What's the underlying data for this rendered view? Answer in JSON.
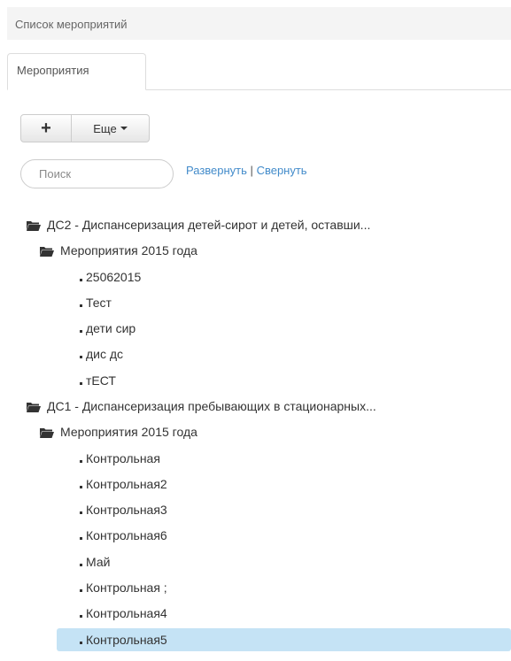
{
  "header": {
    "title": "Список мероприятий"
  },
  "tabs": [
    {
      "label": "Мероприятия"
    }
  ],
  "toolbar": {
    "add_label": "+",
    "more_label": "Еще"
  },
  "search": {
    "placeholder": "Поиск",
    "value": ""
  },
  "links": {
    "expand": "Развернуть",
    "separator": "|",
    "collapse": "Свернуть"
  },
  "tree": [
    {
      "type": "folder",
      "label": "ДС2 - Диспансеризация детей-сирот и детей, оставши..."
    },
    {
      "type": "folder",
      "label": "Мероприятия 2015 года"
    },
    {
      "type": "leaf",
      "label": "25062015"
    },
    {
      "type": "leaf",
      "label": "Тест"
    },
    {
      "type": "leaf",
      "label": "дети сир"
    },
    {
      "type": "leaf",
      "label": "дис дс"
    },
    {
      "type": "leaf",
      "label": "тЕСТ"
    },
    {
      "type": "folder",
      "label": "ДС1 - Диспансеризация пребывающих в стационарных..."
    },
    {
      "type": "folder",
      "label": "Мероприятия 2015 года"
    },
    {
      "type": "leaf",
      "label": "Контрольная"
    },
    {
      "type": "leaf",
      "label": "Контрольная2"
    },
    {
      "type": "leaf",
      "label": "Контрольная3"
    },
    {
      "type": "leaf",
      "label": "Контрольная6"
    },
    {
      "type": "leaf",
      "label": "Май"
    },
    {
      "type": "leaf",
      "label": "Контрольная ;"
    },
    {
      "type": "leaf",
      "label": "Контрольная4"
    },
    {
      "type": "leaf",
      "label": "Контрольная5",
      "selected": true
    }
  ],
  "colors": {
    "link": "#428bca",
    "selection": "#c5e3f5"
  }
}
